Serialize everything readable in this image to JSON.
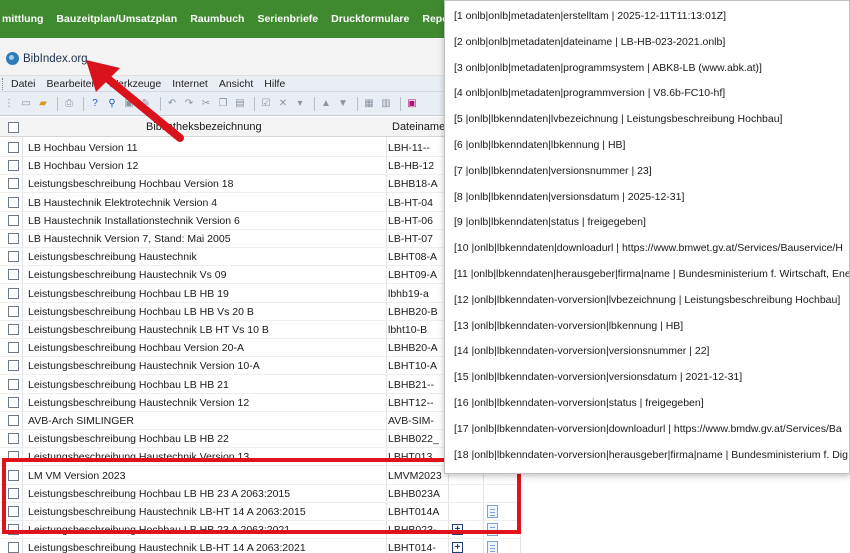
{
  "topnav": [
    "mittlung",
    "Bauzeitplan/Umsatzplan",
    "Raumbuch",
    "Serienbriefe",
    "Druckformulare",
    "Reports"
  ],
  "app": {
    "title": "BibIndex.org"
  },
  "menu": [
    "Datei",
    "Bearbeiten",
    "Werkzeuge",
    "Internet",
    "Ansicht",
    "Hilfe"
  ],
  "toolbar_icons": [
    "grip-icon",
    "new-document-icon",
    "open-folder-icon",
    "print-icon",
    "help-icon",
    "search-icon",
    "save-icon",
    "undo-icon",
    "redo-icon",
    "cut-icon",
    "copy-icon",
    "paste-icon",
    "edit-icon",
    "delete-icon",
    "up-icon",
    "down-icon",
    "table-icon",
    "properties-icon",
    "stop-icon"
  ],
  "table": {
    "headers": {
      "name": "Bibliotheksbezeichnung",
      "file": "Dateiname"
    },
    "rows": [
      {
        "name": "LB Hochbau Version 11",
        "file": "LBH-11--"
      },
      {
        "name": "LB Hochbau Version 12",
        "file": "LB-HB-12"
      },
      {
        "name": "Leistungsbeschreibung Hochbau Version 18",
        "file": "LBHB18-A"
      },
      {
        "name": "LB Haustechnik Elektrotechnik Version 4",
        "file": "LB-HT-04"
      },
      {
        "name": "LB Haustechnik Installationstechnik Version 6",
        "file": "LB-HT-06"
      },
      {
        "name": "LB Haustechnik Version 7, Stand: Mai 2005",
        "file": "LB-HT-07"
      },
      {
        "name": "Leistungsbeschreibung Haustechnik",
        "file": "LBHT08-A"
      },
      {
        "name": "Leistungsbeschreibung Haustechnik Vs 09",
        "file": "LBHT09-A"
      },
      {
        "name": "Leistungsbeschreibung Hochbau LB HB 19",
        "file": "lbhb19-a"
      },
      {
        "name": "Leistungsbeschreibung Hochbau LB HB Vs 20 B",
        "file": "LBHB20-B"
      },
      {
        "name": "Leistungsbeschreibung Haustechnik LB HT Vs 10 B",
        "file": "lbht10-B"
      },
      {
        "name": "Leistungsbeschreibung Hochbau Version 20-A",
        "file": "LBHB20-A"
      },
      {
        "name": "Leistungsbeschreibung Haustechnik Version 10-A",
        "file": "LBHT10-A"
      },
      {
        "name": "Leistungsbeschreibung Hochbau LB HB 21",
        "file": "LBHB21--"
      },
      {
        "name": "Leistungsbeschreibung Haustechnik Version 12",
        "file": "LBHT12--"
      },
      {
        "name": "AVB-Arch SIMLINGER",
        "file": "AVB-SIM-"
      },
      {
        "name": "Leistungsbeschreibung Hochbau LB HB 22",
        "file": "LBHB022_"
      },
      {
        "name": "Leistungsbeschreibung Haustechnik Version 13",
        "file": "LBHT013_"
      },
      {
        "name": "LM VM Version 2023",
        "file": "LMVM2023"
      },
      {
        "name": "Leistungsbeschreibung Hochbau LB HB 23 A 2063:2015",
        "file": "LBHB023A"
      },
      {
        "name": "Leistungsbeschreibung Haustechnik LB-HT 14 A 2063:2015",
        "file": "LBHT014A"
      },
      {
        "name": "Leistungsbeschreibung Hochbau LB HB 23 A 2063:2021",
        "file": "LBHB023-"
      },
      {
        "name": "Leistungsbeschreibung Haustechnik LB-HT 14 A 2063:2021",
        "file": "LBHT014-"
      }
    ]
  },
  "tooltip": [
    "[1 onlb|onlb|metadaten|erstelltam | 2025-12-11T11:13:01Z]",
    "[2 onlb|onlb|metadaten|dateiname | LB-HB-023-2021.onlb]",
    "[3 onlb|onlb|metadaten|programmsystem | ABK8-LB (www.abk.at)]",
    "[4 onlb|onlb|metadaten|programmversion | V8.6b-FC10-hf]",
    "[5 |onlb|lbkenndaten|lvbezeichnung | Leistungsbeschreibung Hochbau]",
    "[6 |onlb|lbkenndaten|lbkennung | HB]",
    "[7 |onlb|lbkenndaten|versionsnummer | 23]",
    "[8 |onlb|lbkenndaten|versionsdatum | 2025-12-31]",
    "[9 |onlb|lbkenndaten|status | freigegeben]",
    "[10 |onlb|lbkenndaten|downloadurl | https://www.bmwet.gv.at/Services/Bauservice/H",
    "[11 |onlb|lbkenndaten|herausgeber|firma|name | Bundesministerium f. Wirtschaft, Ene",
    "[12 |onlb|lbkenndaten-vorversion|lvbezeichnung | Leistungsbeschreibung Hochbau]",
    "[13 |onlb|lbkenndaten-vorversion|lbkennung | HB]",
    "[14 |onlb|lbkenndaten-vorversion|versionsnummer | 22]",
    "[15 |onlb|lbkenndaten-vorversion|versionsdatum | 2021-12-31]",
    "[16 |onlb|lbkenndaten-vorversion|status | freigegeben]",
    "[17 |onlb|lbkenndaten-vorversion|downloadurl | https://www.bmdw.gv.at/Services/Ba",
    "[18 |onlb|lbkenndaten-vorversion|herausgeber|firma|name | Bundesministerium f. Dig"
  ],
  "colors": {
    "nav_green": "#3f8a2e",
    "highlight_red": "#e0121b",
    "arrow_red": "#d9121b"
  }
}
